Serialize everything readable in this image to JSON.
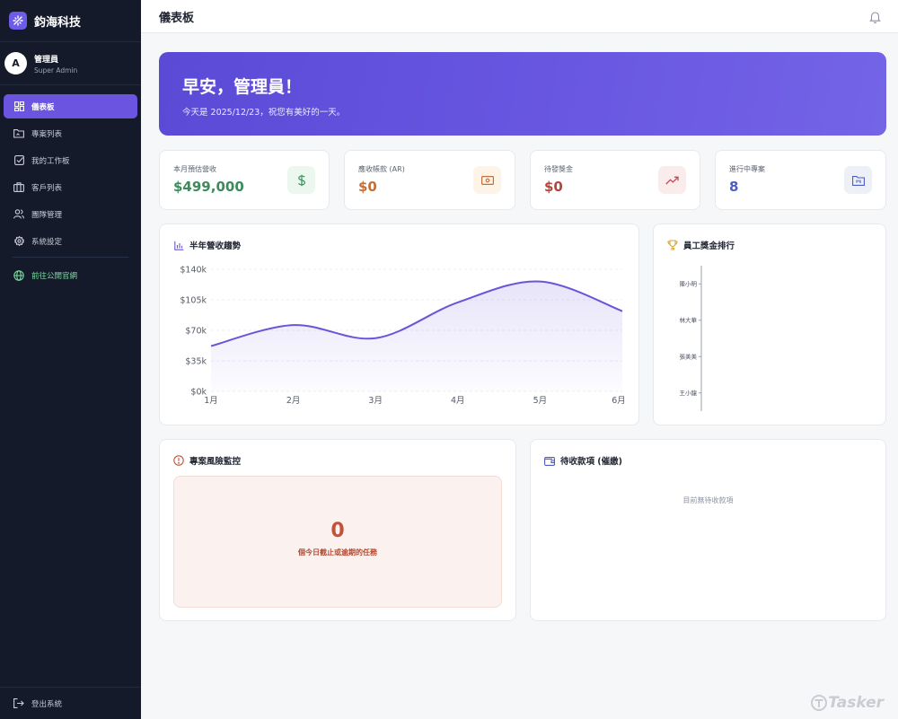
{
  "app": {
    "name": "鈞海科技"
  },
  "user": {
    "initial": "A",
    "name": "管理員",
    "role": "Super Admin"
  },
  "nav": {
    "items": [
      {
        "label": "儀表板",
        "icon": "dashboard-icon",
        "active": true
      },
      {
        "label": "專案列表",
        "icon": "folder-icon"
      },
      {
        "label": "我的工作板",
        "icon": "checkbox-icon"
      },
      {
        "label": "客戶列表",
        "icon": "briefcase-icon"
      },
      {
        "label": "團隊管理",
        "icon": "users-icon"
      },
      {
        "label": "系統設定",
        "icon": "gear-icon"
      }
    ],
    "site_link": "前往公開官網",
    "logout": "登出系統"
  },
  "header": {
    "title": "儀表板"
  },
  "hero": {
    "title": "早安，管理員！",
    "subtitle": "今天是 2025/12/23，祝您有美好的一天。"
  },
  "stats": [
    {
      "label": "本月預估營收",
      "value": "$499,000",
      "color": "#3f8a5c",
      "icon": "dollar-icon",
      "icon_bg": "#ecf7f0"
    },
    {
      "label": "應收帳款 (AR)",
      "value": "$0",
      "color": "#c2703b",
      "icon": "cash-icon",
      "icon_bg": "#fdf3e7"
    },
    {
      "label": "待發獎金",
      "value": "$0",
      "color": "#b5443b",
      "icon": "trend-up-icon",
      "icon_bg": "#fbecec"
    },
    {
      "label": "進行中專案",
      "value": "8",
      "color": "#4b5cc4",
      "icon": "folder-kanban-icon",
      "icon_bg": "#eef0f7"
    }
  ],
  "revenue_panel": {
    "title": "半年營收趨勢"
  },
  "ranking_panel": {
    "title": "員工獎金排行"
  },
  "risk_panel": {
    "title": "專案風險監控",
    "count": "0",
    "description": "個今日截止或逾期的任務"
  },
  "receivable_panel": {
    "title": "待收款項 (催繳)",
    "empty_text": "目前無待收款項"
  },
  "watermark": "Tasker",
  "chart_data": [
    {
      "type": "area",
      "title": "半年營收趨勢",
      "x": [
        "1月",
        "2月",
        "3月",
        "4月",
        "5月",
        "6月"
      ],
      "y_ticks": [
        "$0k",
        "$35k",
        "$70k",
        "$105k",
        "$140k"
      ],
      "ylim": [
        0,
        140000
      ],
      "values": [
        52000,
        76000,
        61000,
        102000,
        126000,
        92000
      ],
      "grid": true,
      "color": "#6a55d8"
    },
    {
      "type": "bar",
      "title": "員工獎金排行",
      "orientation": "horizontal",
      "categories": [
        "陳小明",
        "林大華",
        "張美美",
        "王小龍"
      ],
      "values": [
        0,
        0,
        0,
        0
      ]
    }
  ]
}
